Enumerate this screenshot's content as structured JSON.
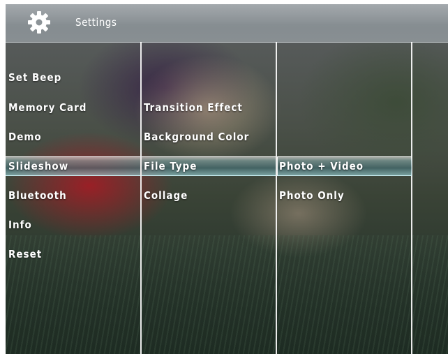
{
  "header": {
    "title": "Settings",
    "icon": "gear-icon"
  },
  "column1": {
    "items": [
      "Set Beep",
      "Memory Card",
      "Demo",
      "Slideshow",
      "Bluetooth",
      "Info",
      "Reset"
    ],
    "selected": "Slideshow"
  },
  "column2": {
    "items": [
      "Transition Effect",
      "Background Color",
      "File Type",
      "Collage"
    ],
    "selected": "File Type"
  },
  "column3": {
    "items": [
      "Photo + Video",
      "Photo Only"
    ],
    "selected": "Photo + Video"
  },
  "colors": {
    "header": "#8c9397",
    "text": "#ffffff",
    "highlight": "#6fa8b0"
  }
}
